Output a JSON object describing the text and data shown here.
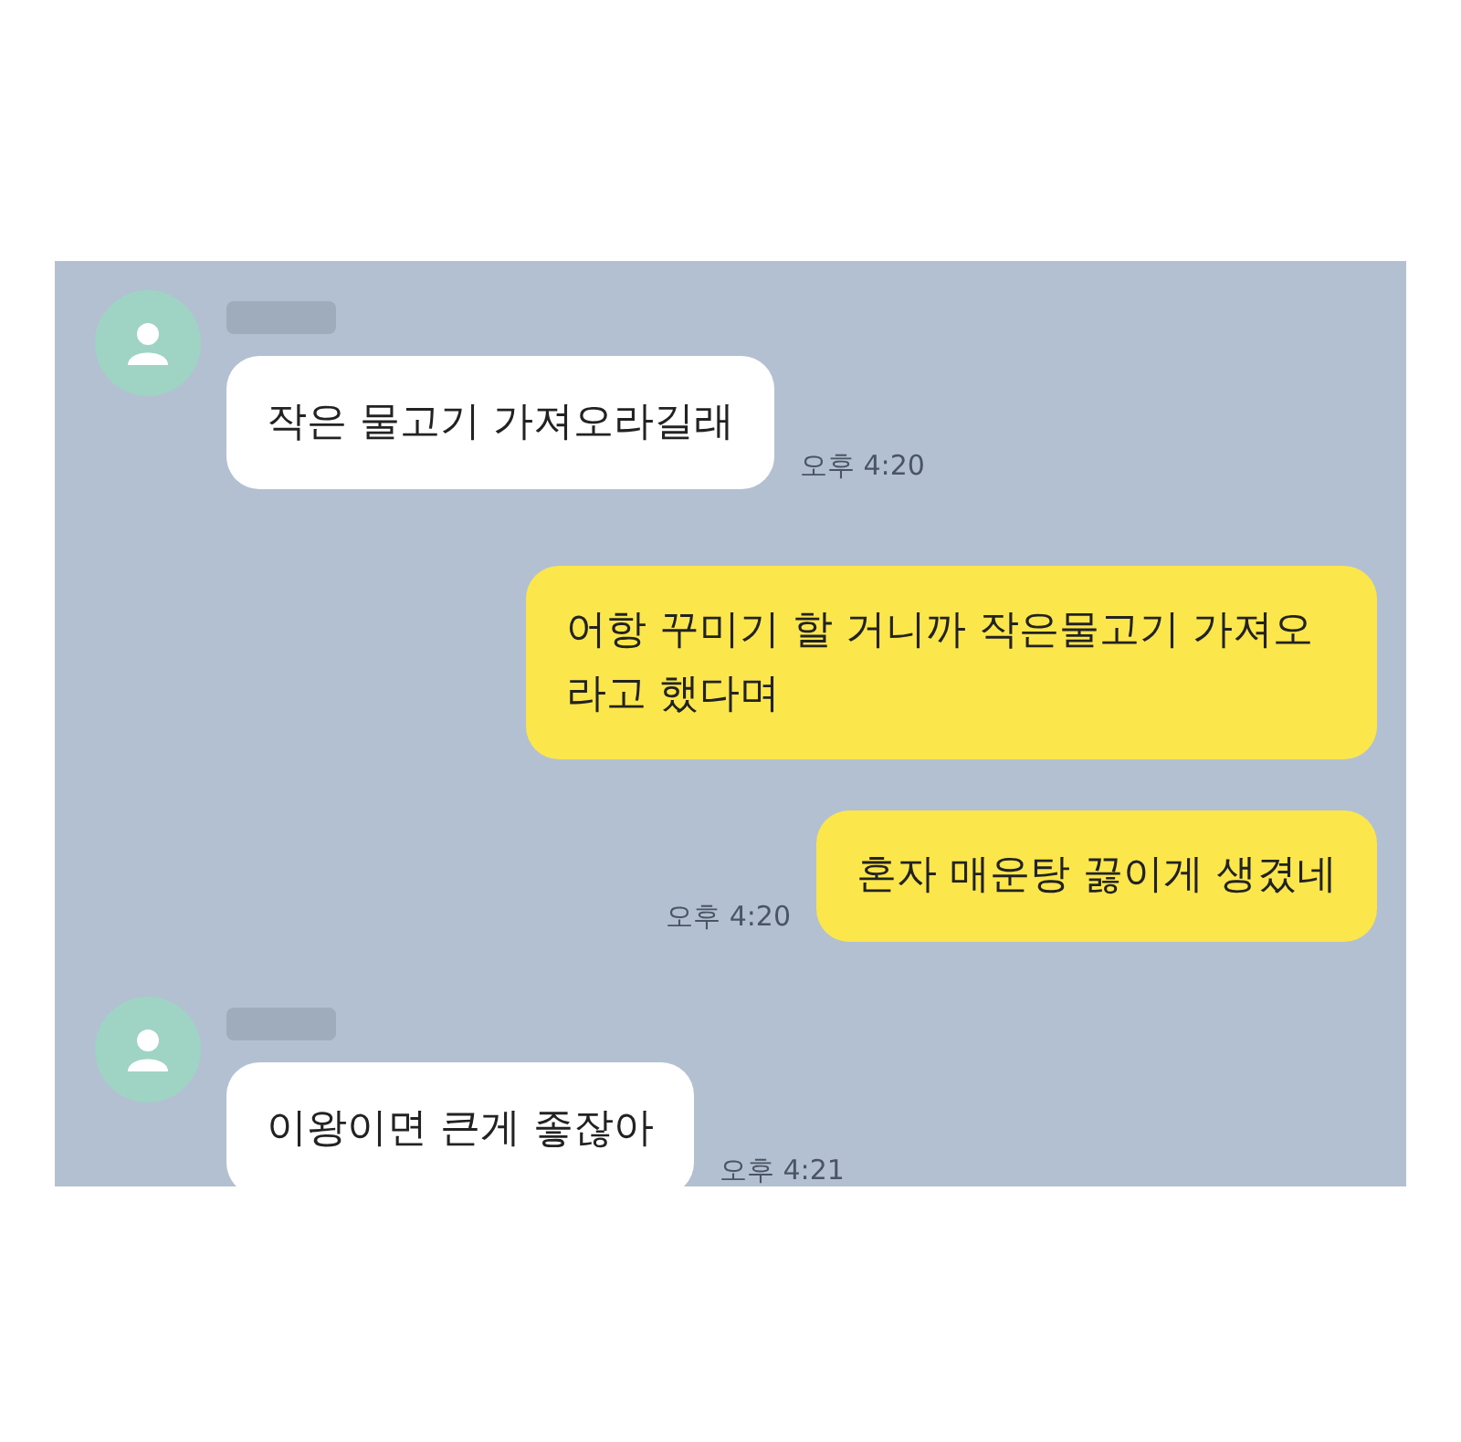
{
  "messages": [
    {
      "kind": "incoming",
      "text": "작은 물고기 가져오라길래",
      "time": "오후 4:20"
    },
    {
      "kind": "outgoing",
      "text": "어항 꾸미기 할 거니까 작은물고기 가져오라고 했다며"
    },
    {
      "kind": "outgoing",
      "text": "혼자 매운탕 끓이게 생겼네",
      "time": "오후 4:20"
    },
    {
      "kind": "incoming",
      "text": "이왕이면 큰게 좋잖아",
      "time": "오후 4:21"
    }
  ]
}
